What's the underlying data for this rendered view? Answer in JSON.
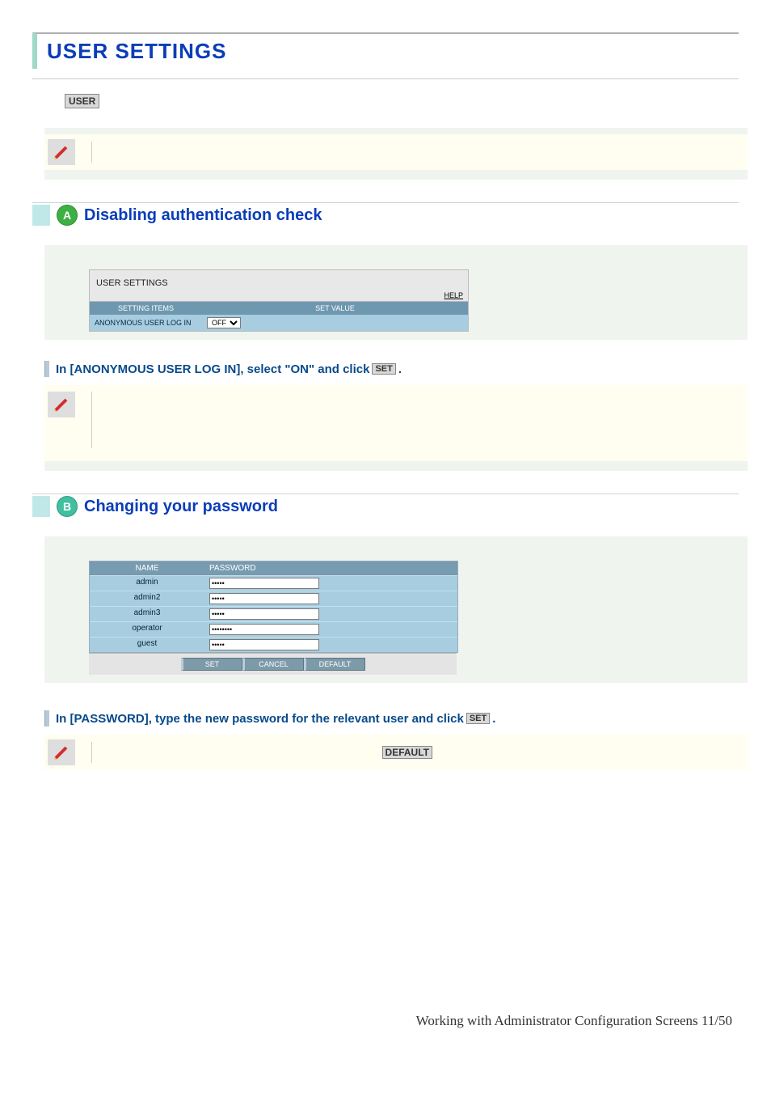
{
  "title": "USER SETTINGS",
  "tab_label": "USER",
  "section_a": {
    "letter": "A",
    "heading": "Disabling authentication check",
    "panel_title": "USER SETTINGS",
    "help": "HELP",
    "col1": "SETTING ITEMS",
    "col2": "SET VALUE",
    "row_label": "ANONYMOUS USER LOG IN",
    "select_value": "OFF",
    "instruction_a": "In [ANONYMOUS USER LOG IN], select \"ON\" and click",
    "instruction_btn": "SET",
    "instruction_end": "."
  },
  "section_b": {
    "letter": "B",
    "heading": "Changing your password",
    "col_name": "NAME",
    "col_pass": "PASSWORD",
    "rows": [
      {
        "name": "admin",
        "pw": "•••••"
      },
      {
        "name": "admin2",
        "pw": "•••••"
      },
      {
        "name": "admin3",
        "pw": "•••••"
      },
      {
        "name": "operator",
        "pw": "••••••••"
      },
      {
        "name": "guest",
        "pw": "•••••"
      }
    ],
    "btn_set": "SET",
    "btn_cancel": "CANCEL",
    "btn_default": "DEFAULT",
    "instruction_b": "In [PASSWORD], type the new password for the relevant user and click",
    "instruction_btn": "SET",
    "instruction_end": "."
  },
  "default_btn": "DEFAULT",
  "footer": "Working with Administrator Configuration Screens 11/50"
}
